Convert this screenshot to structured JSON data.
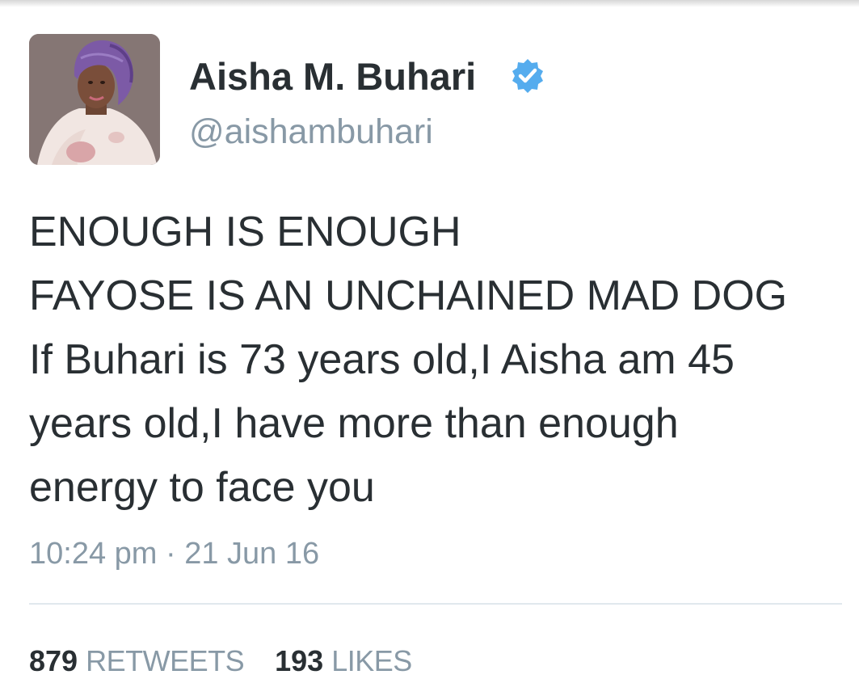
{
  "author": {
    "display_name": "Aisha M. Buhari",
    "handle": "@aishambuhari",
    "verified_icon": "verified-badge-icon",
    "verified_color": "#55acee"
  },
  "tweet": {
    "lines": [
      "ENOUGH IS ENOUGH",
      "FAYOSE IS AN UNCHAINED MAD DOG",
      "If Buhari is 73 years old,I Aisha am 45",
      "years old,I have more than enough",
      "energy to face you"
    ],
    "timestamp": "10:24 pm · 21 Jun 16"
  },
  "stats": {
    "retweets_count": "879",
    "retweets_label": "RETWEETS",
    "likes_count": "193",
    "likes_label": "LIKES"
  },
  "colors": {
    "text": "#292f33",
    "secondary_text": "#8899a6",
    "divider": "#e1e8ed"
  }
}
